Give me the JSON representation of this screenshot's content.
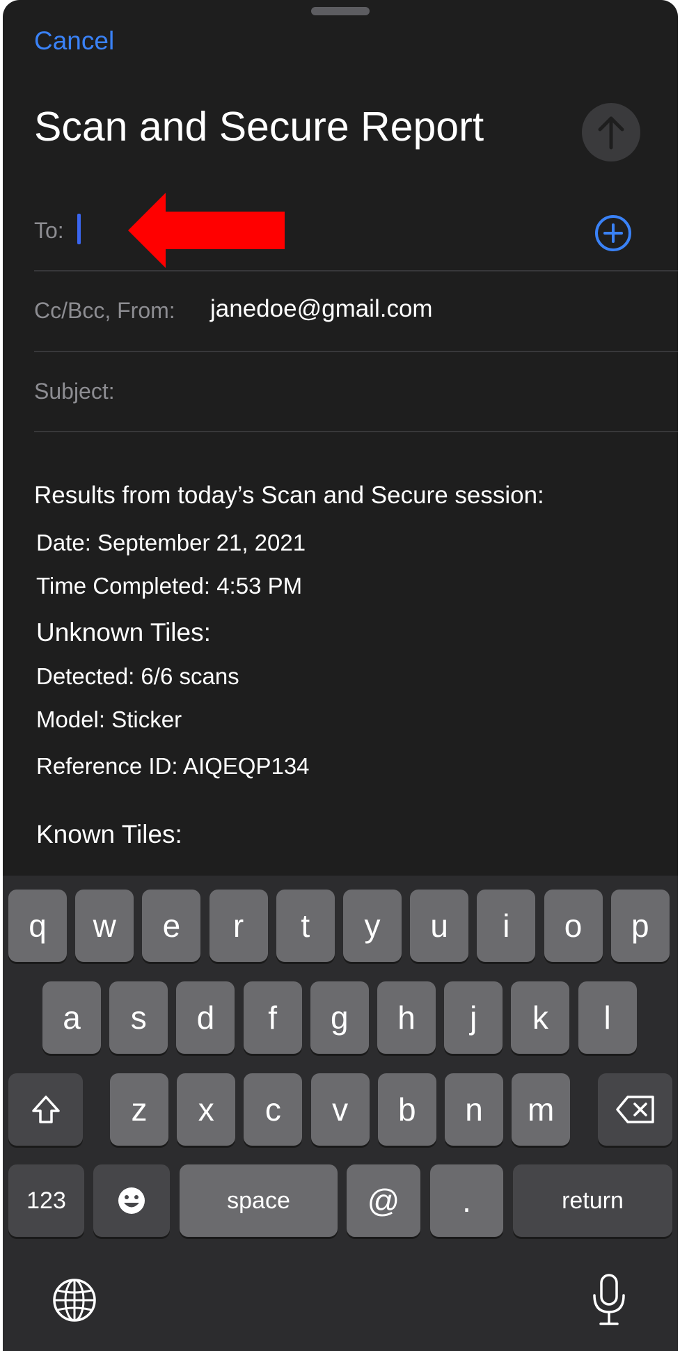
{
  "header": {
    "cancel_label": "Cancel",
    "title": "Scan and Secure Report"
  },
  "fields": {
    "to_label": "To:",
    "to_value": "",
    "ccbcc_label": "Cc/Bcc, From:",
    "from_value": "janedoe@gmail.com",
    "subject_label": "Subject:",
    "subject_value": ""
  },
  "body": {
    "intro": "Results from today’s Scan and Secure session:",
    "date": "Date: September 21, 2021",
    "time": "Time Completed: 4:53 PM",
    "unknown_heading": "Unknown Tiles:",
    "detected": "Detected: 6/6 scans",
    "model": "Model: Sticker",
    "reference": "Reference ID: AIQEQP134",
    "known_heading": "Known Tiles:"
  },
  "keyboard": {
    "row1": [
      "q",
      "w",
      "e",
      "r",
      "t",
      "y",
      "u",
      "i",
      "o",
      "p"
    ],
    "row2": [
      "a",
      "s",
      "d",
      "f",
      "g",
      "h",
      "j",
      "k",
      "l"
    ],
    "row3": [
      "z",
      "x",
      "c",
      "v",
      "b",
      "n",
      "m"
    ],
    "numbers_label": "123",
    "space_label": "space",
    "at_label": "@",
    "dot_label": ".",
    "return_label": "return"
  },
  "colors": {
    "accent": "#3a82f7",
    "background": "#1e1e1e",
    "annotation_arrow": "#ff0000"
  },
  "icons": {
    "send": "arrow-up-icon",
    "add_contact": "plus-circle-icon",
    "shift": "shift-icon",
    "delete": "backspace-icon",
    "emoji": "emoji-icon",
    "globe": "globe-icon",
    "dictation": "microphone-icon"
  }
}
